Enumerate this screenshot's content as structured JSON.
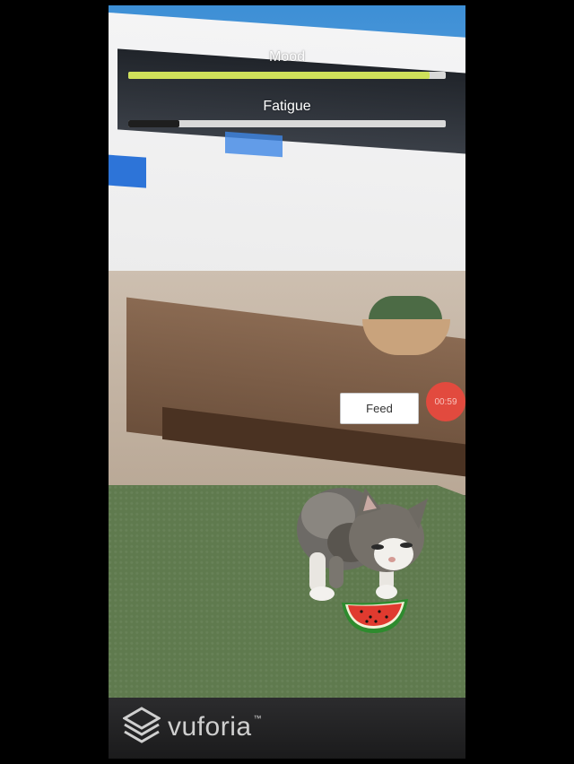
{
  "hud": {
    "mood": {
      "label": "Mood",
      "value": 0.95,
      "color": "#cfe05a",
      "track_color": "#d9d9d9"
    },
    "fatigue": {
      "label": "Fatigue",
      "value": 0.16,
      "color": "#1e1e1e",
      "track_color": "#d9d9d9"
    }
  },
  "actions": {
    "feed_label": "Feed"
  },
  "timer": {
    "text": "00:59",
    "color": "#e24a3e"
  },
  "scene": {
    "pet": "cat",
    "food": "watermelon-slice",
    "ground_color": "#5f7a4e"
  },
  "branding": {
    "logo_icon": "vuforia-cube-icon",
    "name": "vuforia",
    "trademark": "™"
  }
}
